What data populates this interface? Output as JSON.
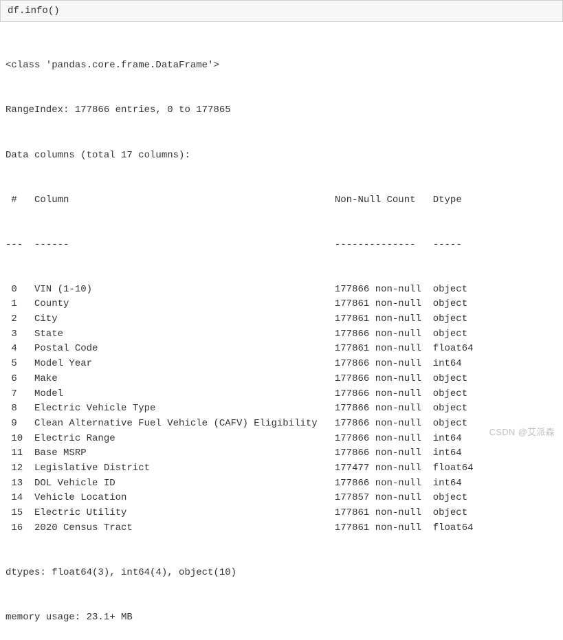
{
  "code": {
    "obj": "df",
    "dot": ".",
    "method": "info",
    "open": "(",
    "close": ")"
  },
  "output": {
    "class_line": "<class 'pandas.core.frame.DataFrame'>",
    "range_line": "RangeIndex: 177866 entries, 0 to 177865",
    "datacols_line": "Data columns (total 17 columns):",
    "header": {
      "idx": " # ",
      "col": "Column",
      "nn": "Non-Null Count",
      "dtype": "Dtype"
    },
    "divider": {
      "idx": "---",
      "col": "------",
      "nn": "--------------",
      "dtype": "-----"
    },
    "rows": [
      {
        "idx": " 0 ",
        "col": "VIN (1-10)",
        "nn": "177866 non-null",
        "dtype": "object"
      },
      {
        "idx": " 1 ",
        "col": "County",
        "nn": "177861 non-null",
        "dtype": "object"
      },
      {
        "idx": " 2 ",
        "col": "City",
        "nn": "177861 non-null",
        "dtype": "object"
      },
      {
        "idx": " 3 ",
        "col": "State",
        "nn": "177866 non-null",
        "dtype": "object"
      },
      {
        "idx": " 4 ",
        "col": "Postal Code",
        "nn": "177861 non-null",
        "dtype": "float64"
      },
      {
        "idx": " 5 ",
        "col": "Model Year",
        "nn": "177866 non-null",
        "dtype": "int64"
      },
      {
        "idx": " 6 ",
        "col": "Make",
        "nn": "177866 non-null",
        "dtype": "object"
      },
      {
        "idx": " 7 ",
        "col": "Model",
        "nn": "177866 non-null",
        "dtype": "object"
      },
      {
        "idx": " 8 ",
        "col": "Electric Vehicle Type",
        "nn": "177866 non-null",
        "dtype": "object"
      },
      {
        "idx": " 9 ",
        "col": "Clean Alternative Fuel Vehicle (CAFV) Eligibility",
        "nn": "177866 non-null",
        "dtype": "object"
      },
      {
        "idx": " 10",
        "col": "Electric Range",
        "nn": "177866 non-null",
        "dtype": "int64"
      },
      {
        "idx": " 11",
        "col": "Base MSRP",
        "nn": "177866 non-null",
        "dtype": "int64"
      },
      {
        "idx": " 12",
        "col": "Legislative District",
        "nn": "177477 non-null",
        "dtype": "float64"
      },
      {
        "idx": " 13",
        "col": "DOL Vehicle ID",
        "nn": "177866 non-null",
        "dtype": "int64"
      },
      {
        "idx": " 14",
        "col": "Vehicle Location",
        "nn": "177857 non-null",
        "dtype": "object"
      },
      {
        "idx": " 15",
        "col": "Electric Utility",
        "nn": "177861 non-null",
        "dtype": "object"
      },
      {
        "idx": " 16",
        "col": "2020 Census Tract",
        "nn": "177861 non-null",
        "dtype": "float64"
      }
    ],
    "dtypes_line": "dtypes: float64(3), int64(4), object(10)",
    "memory_line": "memory usage: 23.1+ MB"
  },
  "widths": {
    "idx": 4,
    "col": 52,
    "nn": 17
  },
  "watermark": "CSDN @艾派森"
}
